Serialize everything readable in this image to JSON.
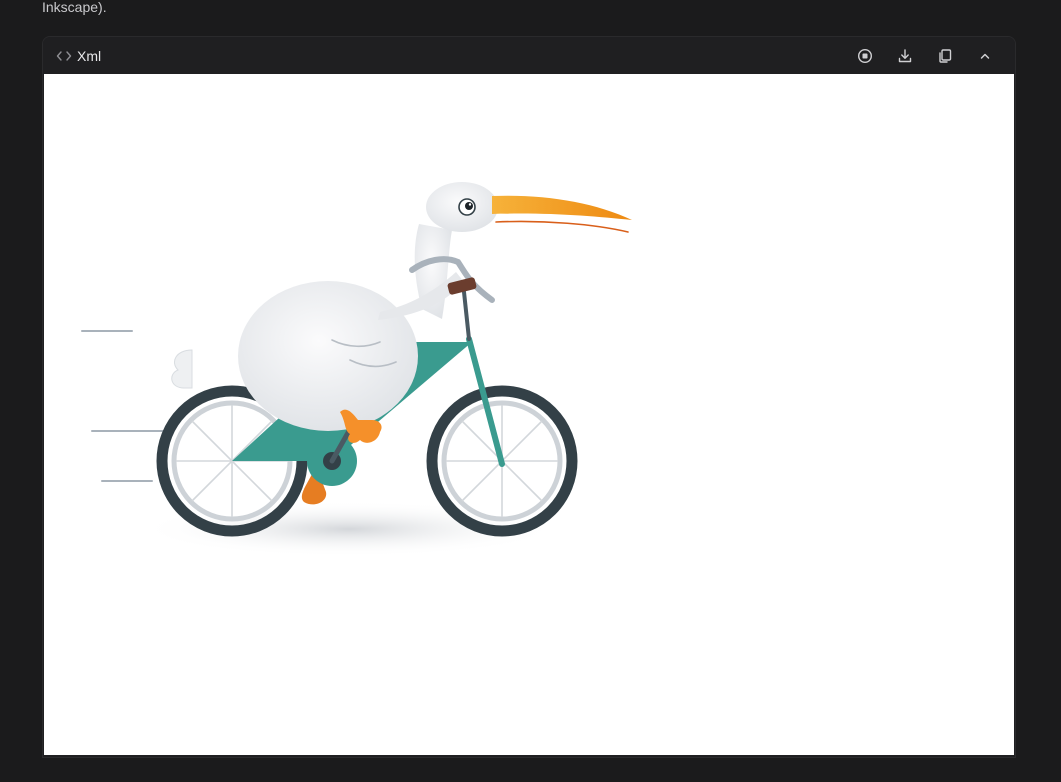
{
  "intro": {
    "text": "Inkscape)."
  },
  "panel": {
    "language_label": "Xml",
    "icons": {
      "language": "code-brackets-icon",
      "stop": "stop-circle-icon",
      "download": "download-icon",
      "copy": "copy-icon",
      "collapse": "chevron-up-icon"
    }
  },
  "illustration": {
    "subject": "bird-riding-bicycle-illustration",
    "colors": {
      "frame": "#3a9b8f",
      "tire": "#334047",
      "beak": "#f29a1f",
      "feet": "#f5902a",
      "body": "#eceef0"
    }
  }
}
